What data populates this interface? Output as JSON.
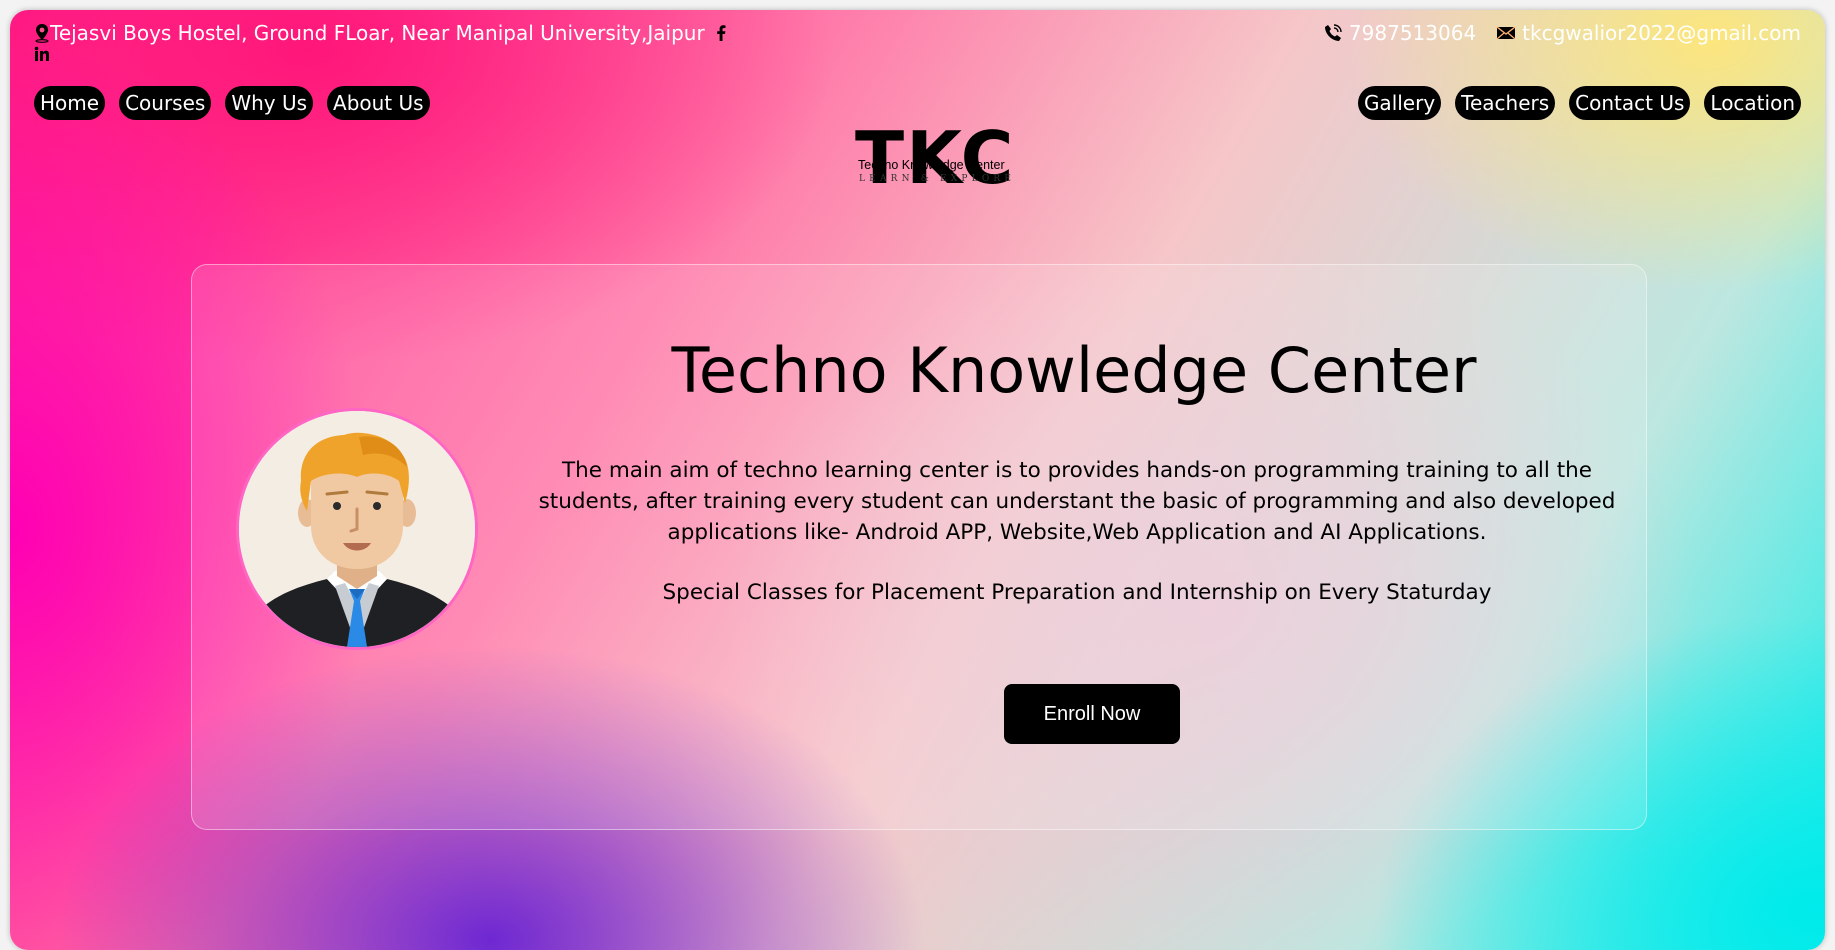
{
  "topbar": {
    "address": "Tejasvi Boys Hostel, Ground FLoar, Near Manipal University,Jaipur",
    "phone": "7987513064",
    "email": "tkcgwalior2022@gmail.com",
    "icons": [
      "location-pin-icon",
      "facebook-icon",
      "linkedin-icon",
      "phone-icon",
      "mail-icon"
    ]
  },
  "nav": {
    "left": [
      "Home",
      "Courses",
      "Why Us",
      "About Us"
    ],
    "right": [
      "Gallery",
      "Teachers",
      "Contact Us",
      "Location"
    ]
  },
  "logo": {
    "letters": "TKC",
    "name": "Techno Knowledge Center",
    "tagline": "LEARN & EXPLORE"
  },
  "hero": {
    "title": "Techno Knowledge Center",
    "description": "The main aim of techno learning center is to provides hands-on programming training to all the students, after training every student can understant the basic of programming and also developed applications like- Android APP, Website,Web Application and AI Applications.",
    "special": "Special Classes for Placement Preparation and Internship on Every Staturday",
    "cta": "Enroll Now"
  },
  "colors": {
    "pill_bg": "#000000",
    "button_bg": "#000000",
    "avatar_border": "#ff66c4"
  }
}
